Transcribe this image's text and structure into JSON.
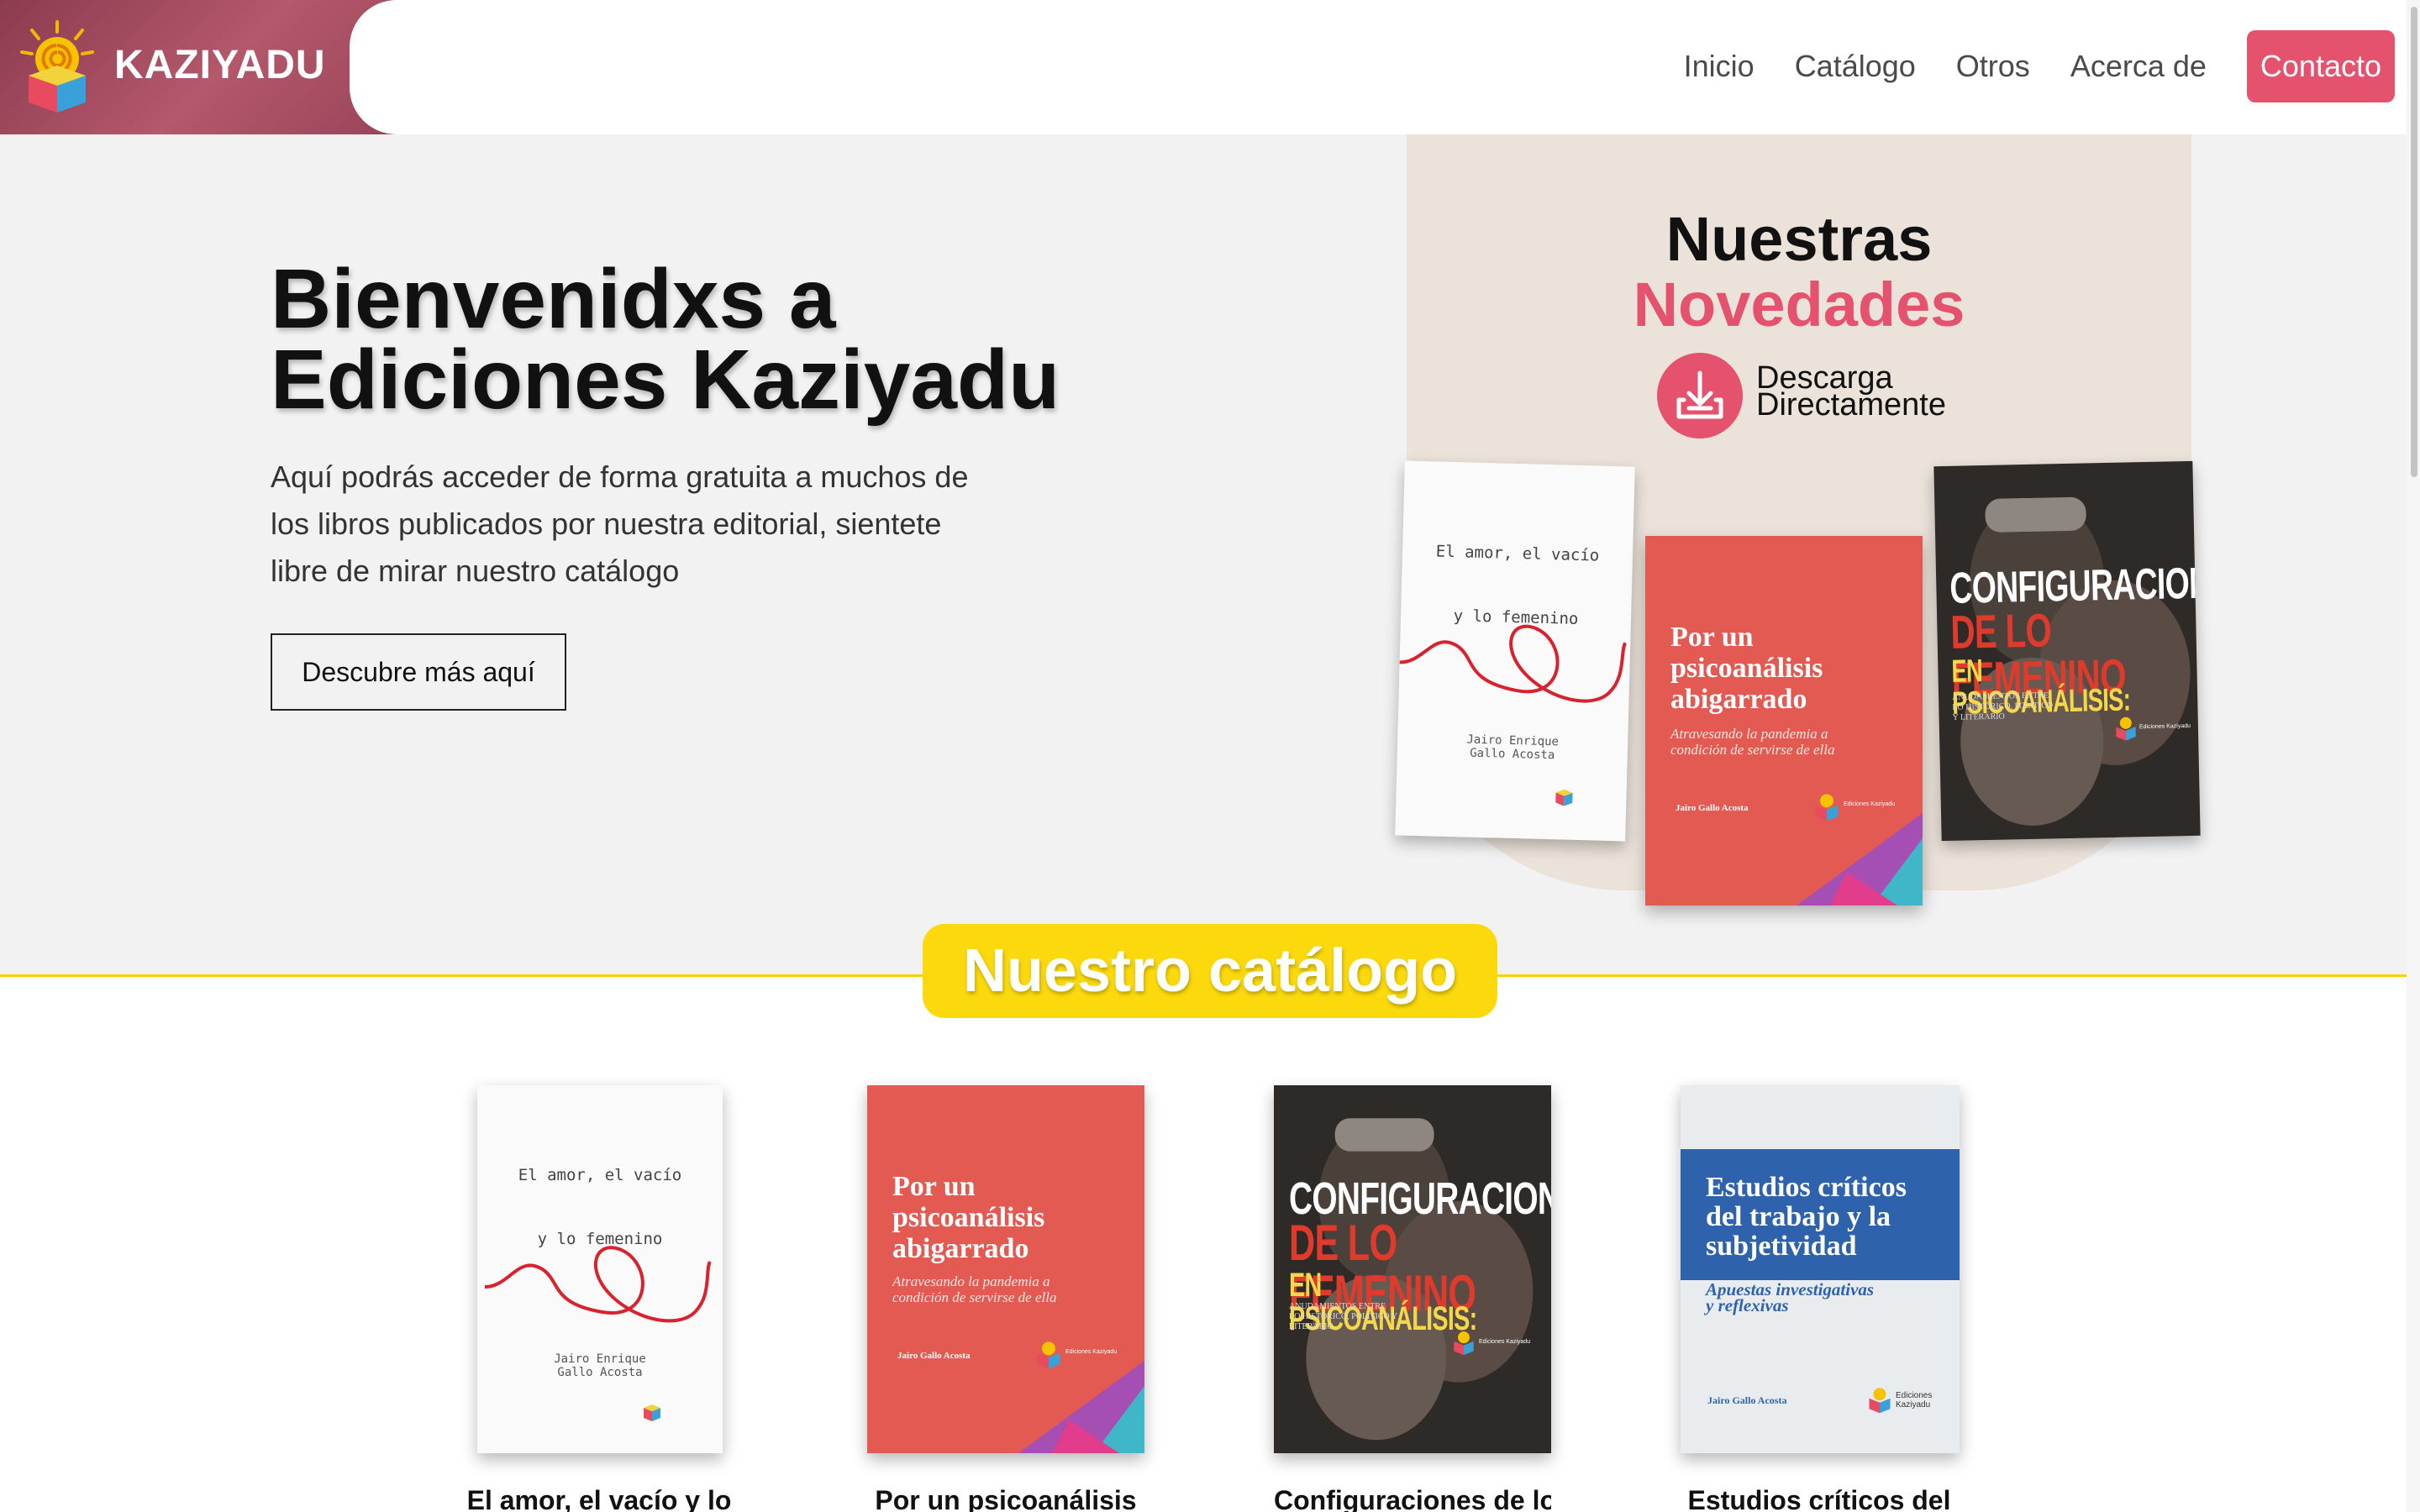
{
  "brand": {
    "name": "KAZIYADU"
  },
  "nav": {
    "items": [
      "Inicio",
      "Catálogo",
      "Otros",
      "Acerca de"
    ],
    "contact": "Contacto"
  },
  "hero": {
    "title_line1": "Bienvenidxs a",
    "title_line2": "Ediciones Kaziyadu",
    "description": "Aquí podrás acceder de forma gratuita a muchos de los libros publicados por nuestra editorial, sientete libre de mirar nuestro catálogo",
    "button": "Descubre más aquí"
  },
  "novedades": {
    "title_line1": "Nuestras",
    "title_line2": "Novedades",
    "download_line1": "Descarga",
    "download_line2": "Directamente"
  },
  "books": {
    "amor": {
      "title_line1": "El amor, el vacío",
      "title_line2": "y lo femenino",
      "author_line1": "Jairo Enrique",
      "author_line2": "Gallo Acosta"
    },
    "psico": {
      "title_line1": "Por un",
      "title_line2": "psicoanálisis",
      "title_line3": "abigarrado",
      "subtitle_line1": "Atravesando la pandemia a",
      "subtitle_line2": "condición de servirse de ella",
      "author": "Jairo Gallo Acosta",
      "publisher": "Ediciones Kaziyadu"
    },
    "config": {
      "title_line1": "CONFIGURACIONES",
      "title_line2": "DE LO FEMENINO",
      "title_line3": "EN PSICOANÁLISIS:",
      "subtitle": "ANUDAMIENTOS ENTRE LO HISTÓRICO, POLÍTICO Y LITERARIO",
      "publisher": "Ediciones Kaziyadu"
    },
    "estudios": {
      "title_line1": "Estudios críticos",
      "title_line2": "del trabajo y la",
      "title_line3": "subjetividad",
      "subtitle_line1": "Apuestas investigativas",
      "subtitle_line2": "y reflexivas",
      "author": "Jairo Gallo Acosta",
      "publisher_line1": "Ediciones",
      "publisher_line2": "Kaziyadu"
    }
  },
  "catalog": {
    "heading": "Nuestro catálogo",
    "captions": [
      "El amor, el vacío y lo",
      "Por un psicoanálisis",
      "Configuraciones de lo",
      "Estudios críticos del"
    ]
  },
  "colors": {
    "accent": "#e5526e",
    "yellow": "#fbd90c",
    "hero_bg": "#f2f2f2",
    "novedades_bg": "#ebe3da"
  }
}
